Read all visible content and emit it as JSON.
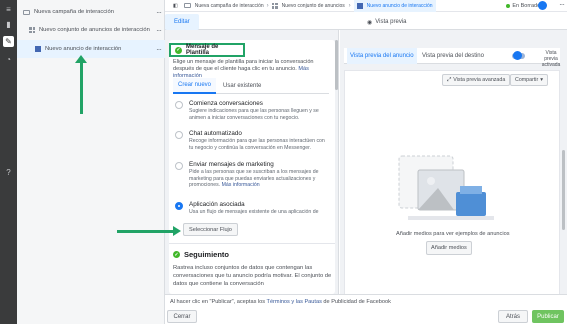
{
  "tree": {
    "items": [
      {
        "label": "Nueva campaña de interacción"
      },
      {
        "label": "Nuevo conjunto de anuncios de interacción"
      },
      {
        "label": "Nuevo anuncio de interacción"
      }
    ],
    "more": "···"
  },
  "breadcrumb": {
    "campaign": "Nueva campaña de interacción",
    "adset": "Nuevo conjunto de anuncios de inte...",
    "ad": "Nuevo anuncio de interacción"
  },
  "status": {
    "label": "En Borrador"
  },
  "tabs": {
    "edit": "Editar",
    "preview": "Vista previa"
  },
  "template": {
    "title": "Mensaje de Plantilla",
    "description_pre": "Elige un mensaje de plantilla para iniciar la conversación después de que el cliente haga clic en tu anuncio. ",
    "description_link": "Más información",
    "tab_new": "Crear nuevo",
    "tab_existing": "Usar existente",
    "options": [
      {
        "title": "Comienza conversaciones",
        "desc": "Sugiere indicaciones para que las personas lleguen y se animen a iniciar conversaciones con tu negocio.",
        "link": ""
      },
      {
        "title": "Chat automatizado",
        "desc": "Recoge información para que las personas interactúen con tu negocio y continúa la conversación en Messenger.",
        "link": ""
      },
      {
        "title": "Enviar mensajes de marketing",
        "desc": "Pide a las personas que se suscriban a los mensajes de marketing para que puedas enviarles actualizaciones y promociones. ",
        "link": "Más información"
      },
      {
        "title": "Aplicación asociada",
        "desc": "Usa un flujo de mensajes existente de una aplicación de",
        "link": ""
      }
    ],
    "select_flow": "Seleccionar Flujo"
  },
  "tracking": {
    "title": "Seguimiento",
    "description": "Rastrea incluso conjuntos de datos que contengan las conversaciones que tu anuncio podría motivar. El conjunto de datos que contiene la conversación"
  },
  "preview": {
    "tab_ad": "Vista previa del anuncio",
    "tab_destination": "Vista previa del destino",
    "toggle_label": "Vista previa activada",
    "advanced": "Vista previa avanzada",
    "share": "Compartir",
    "empty_text": "Añadir medios para ver ejemplos de anuncios",
    "add_media": "Añadir medios"
  },
  "footer": {
    "terms_pre": "Al hacer clic en \"Publicar\", aceptas los ",
    "terms_link": "Términos y las Pautas",
    "terms_post": " de Publicidad de Facebook",
    "close": "Cerrar",
    "back": "Atrás",
    "publish": "Publicar"
  },
  "icons": [
    "chart-icon",
    "pencil-icon",
    "clock-icon",
    "help-icon",
    "folder-icon",
    "grid-icon",
    "ad-square-icon",
    "check-icon",
    "eye-icon"
  ],
  "colors": {
    "accent": "#1877f2",
    "annotation": "#21a366",
    "success": "#42b72a"
  }
}
